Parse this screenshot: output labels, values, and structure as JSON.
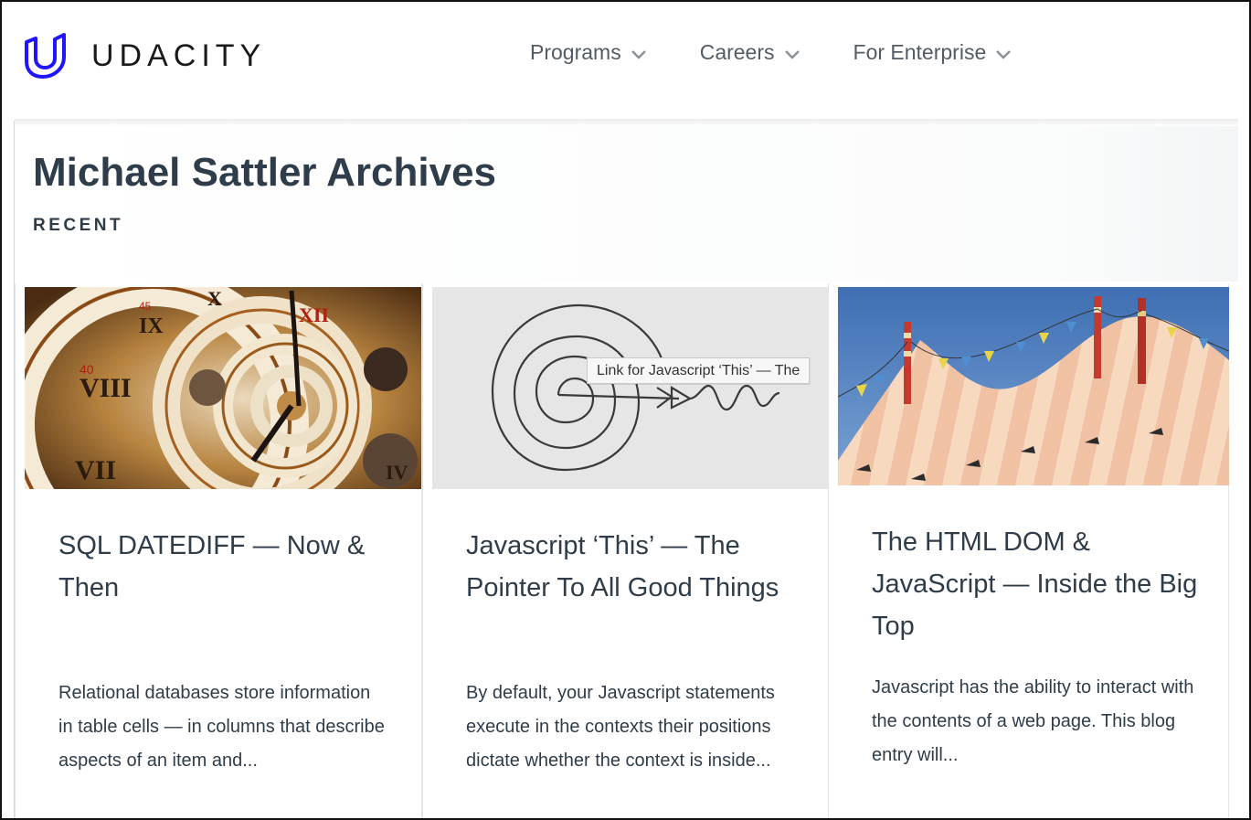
{
  "brand": {
    "name": "UDACITY",
    "logo_color": "#2015ff"
  },
  "nav": {
    "items": [
      {
        "label": "Programs",
        "icon": "chevron-down-icon"
      },
      {
        "label": "Careers",
        "icon": "chevron-down-icon"
      },
      {
        "label": "For Enterprise",
        "icon": "chevron-down-icon"
      }
    ]
  },
  "page": {
    "title": "Michael Sattler Archives",
    "section_label": "RECENT"
  },
  "cards": [
    {
      "image": "spiral-clock-image",
      "title": "SQL DATEDIFF — Now & Then",
      "excerpt": "Relational databases store information in table cells — in columns that describe aspects of an item and..."
    },
    {
      "image": "spiral-target-arrow-image",
      "title": "Javascript ‘This’ — The Pointer To All Good Things",
      "excerpt": "By default, your Javascript statements execute in the contexts their positions dictate whether the context is inside..."
    },
    {
      "image": "circus-tent-image",
      "title": "The HTML DOM & JavaScript — Inside the Big Top",
      "excerpt": "Javascript has the ability to interact with the contents of a web page. This blog entry will..."
    }
  ],
  "tooltip": {
    "text": "Link for Javascript ‘This’ — The"
  },
  "colors": {
    "text": "#2e3d49",
    "nav": "#525c65",
    "accent": "#2015ff"
  }
}
